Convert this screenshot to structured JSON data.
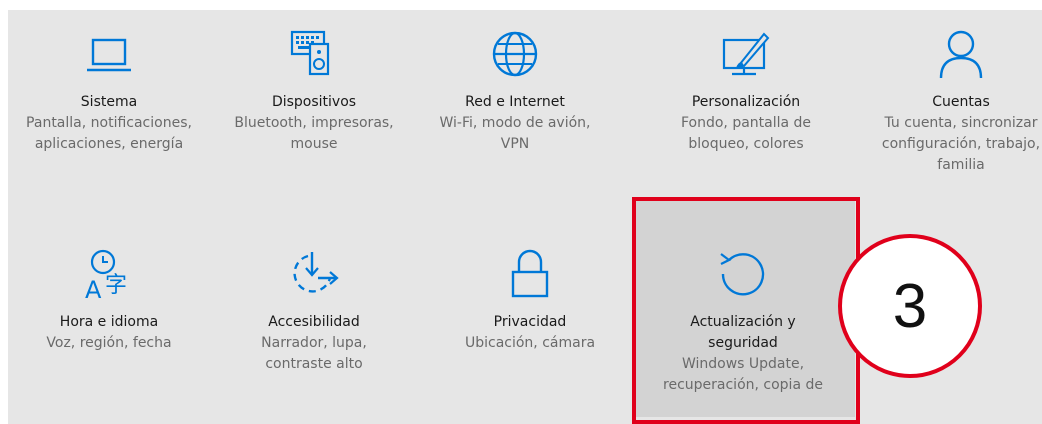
{
  "accent_color": "#0078d7",
  "highlight_color": "#e0001b",
  "tiles": [
    {
      "icon": "laptop-icon",
      "title": "Sistema",
      "desc": "Pantalla, notificaciones,\naplicaciones, energía"
    },
    {
      "icon": "devices-icon",
      "title": "Dispositivos",
      "desc": "Bluetooth, impresoras,\nmouse"
    },
    {
      "icon": "globe-icon",
      "title": "Red e Internet",
      "desc": "Wi-Fi, modo de avión,\nVPN"
    },
    {
      "icon": "personalization-icon",
      "title": "Personalización",
      "desc": "Fondo, pantalla de\nbloqueo, colores"
    },
    {
      "icon": "person-icon",
      "title": "Cuentas",
      "desc": "Tu cuenta, sincronizar\nconfiguración, trabajo,\nfamilia"
    },
    {
      "icon": "time-language-icon",
      "title": "Hora e idioma",
      "desc": "Voz, región, fecha"
    },
    {
      "icon": "accessibility-icon",
      "title": "Accesibilidad",
      "desc": "Narrador, lupa,\ncontraste alto"
    },
    {
      "icon": "lock-icon",
      "title": "Privacidad",
      "desc": "Ubicación, cámara"
    },
    {
      "icon": "update-icon",
      "title": "Actualización y\nseguridad",
      "desc": "Windows Update,\nrecuperación, copia de"
    }
  ],
  "step_marker": "3"
}
